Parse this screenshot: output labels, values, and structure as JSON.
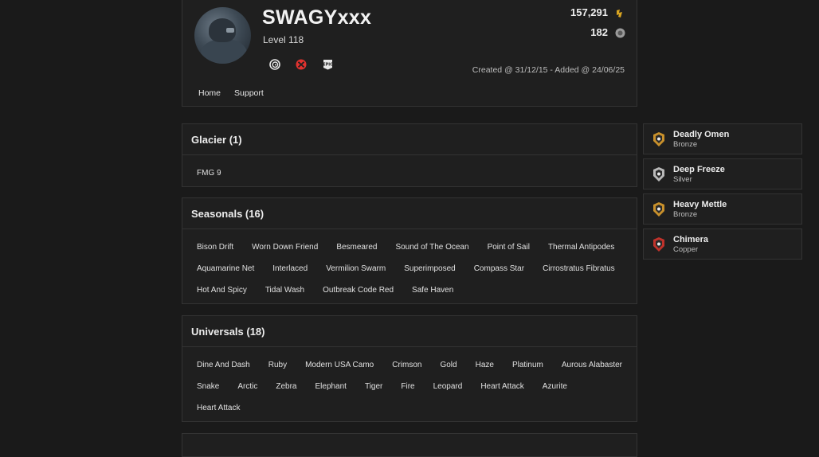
{
  "profile": {
    "username": "SWAGYxxx",
    "level": "Level 118",
    "credits": "157,291",
    "renown": "182",
    "created": "Created @ 31/12/15 - Added @ 24/06/25",
    "platforms": [
      "ubisoft-icon",
      "xbox-icon",
      "epic-games-icon"
    ]
  },
  "nav": {
    "home": "Home",
    "support": "Support"
  },
  "colors": {
    "background": "#1a1a1a",
    "panel": "#1f1f1f",
    "border": "#333333",
    "xbox": "#e0322f",
    "bronze": "#c8902b",
    "silver": "#b9b9b9",
    "copper": "#c0322b"
  },
  "sections": {
    "glacier": {
      "title": "Glacier (1)",
      "items": [
        "FMG 9"
      ]
    },
    "seasonals": {
      "title": "Seasonals (16)",
      "items": [
        "Bison Drift",
        "Worn Down Friend",
        "Besmeared",
        "Sound of The Ocean",
        "Point of Sail",
        "Thermal Antipodes",
        "Aquamarine Net",
        "Interlaced",
        "Vermilion Swarm",
        "Superimposed",
        "Compass Star",
        "Cirrostratus Fibratus",
        "Hot And Spicy",
        "Tidal Wash",
        "Outbreak Code Red",
        "Safe Haven"
      ]
    },
    "universals": {
      "title": "Universals (18)",
      "items": [
        "Dine And Dash",
        "Ruby",
        "Modern USA Camo",
        "Crimson",
        "Gold",
        "Haze",
        "Platinum",
        "Aurous Alabaster",
        "Snake",
        "Arctic",
        "Zebra",
        "Elephant",
        "Tiger",
        "Fire",
        "Leopard",
        "Heart Attack",
        "Azurite",
        "Heart Attack"
      ]
    }
  },
  "ranks": [
    {
      "name": "Deadly Omen",
      "tier": "Bronze",
      "icon": "bronze-rank-icon"
    },
    {
      "name": "Deep Freeze",
      "tier": "Silver",
      "icon": "silver-rank-icon"
    },
    {
      "name": "Heavy Mettle",
      "tier": "Bronze",
      "icon": "bronze-rank-icon"
    },
    {
      "name": "Chimera",
      "tier": "Copper",
      "icon": "copper-rank-icon"
    }
  ]
}
